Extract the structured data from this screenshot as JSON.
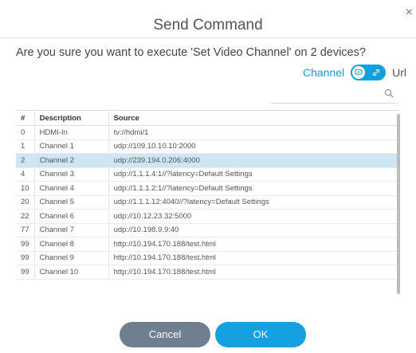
{
  "dialog": {
    "title": "Send Command",
    "close_label": "×",
    "question": "Are you sure you want to execute 'Set Video Channel' on 2 devices?"
  },
  "toggle": {
    "left_label": "Channel",
    "right_label": "Url",
    "selected": "Channel",
    "accent_color": "#0fa0e0",
    "left_icon": "chat-icon",
    "right_icon": "link-icon"
  },
  "search": {
    "icon": "search-icon",
    "value": ""
  },
  "table": {
    "headers": [
      "#",
      "Description",
      "Source"
    ],
    "rows": [
      {
        "num": "0",
        "description": "HDMI-In",
        "source": "tv://hdmi/1",
        "selected": false
      },
      {
        "num": "1",
        "description": "Channel 1",
        "source": "udp://109.10.10.10:2000",
        "selected": false
      },
      {
        "num": "2",
        "description": "Channel 2",
        "source": "udp://239.194.0.206:4000",
        "selected": true
      },
      {
        "num": "4",
        "description": "Channel 3",
        "source": "udp://1.1.1.4:1//?latency=Default Settings",
        "selected": false
      },
      {
        "num": "10",
        "description": "Channel 4",
        "source": "udp://1.1.1.2:1//?latency=Default Settings",
        "selected": false
      },
      {
        "num": "20",
        "description": "Channel 5",
        "source": "udp://1.1.1.12:4040//?latency=Default Settings",
        "selected": false
      },
      {
        "num": "22",
        "description": "Channel 6",
        "source": "udp://10.12.23.32:5000",
        "selected": false
      },
      {
        "num": "77",
        "description": "Channel 7",
        "source": "udp://10.198.9.9:40",
        "selected": false
      },
      {
        "num": "99",
        "description": "Channel 8",
        "source": "http://10.194.170.188/test.html",
        "selected": false
      },
      {
        "num": "99",
        "description": "Channel 9",
        "source": "http://10.194.170.188/test.html",
        "selected": false
      },
      {
        "num": "99",
        "description": "Channel 10",
        "source": "http://10.194.170.188/test.html",
        "selected": false
      }
    ]
  },
  "buttons": {
    "cancel_label": "Cancel",
    "ok_label": "OK"
  }
}
